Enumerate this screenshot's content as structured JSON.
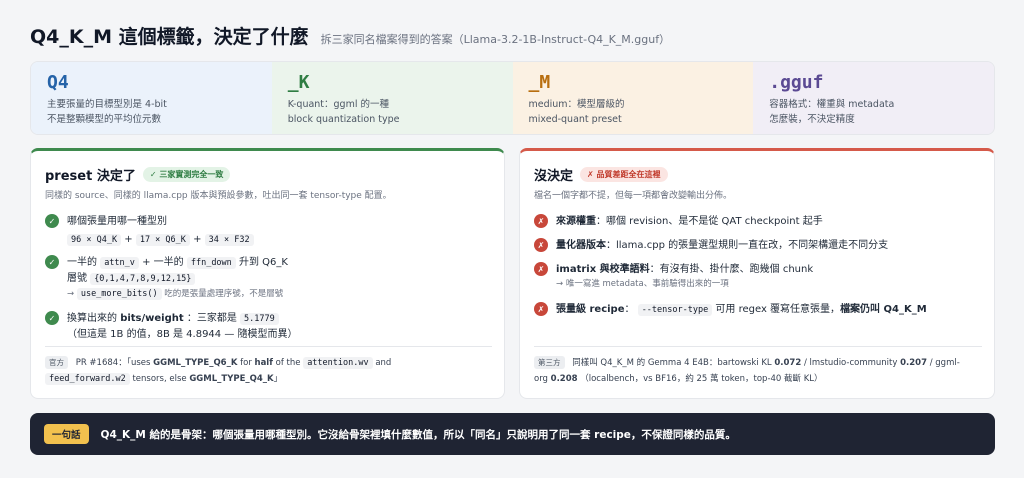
{
  "header": {
    "title": "Q4_K_M 這個標籤，決定了什麼",
    "subtitle": "拆三家同名檔案得到的答案（Llama-3.2-1B-Instruct-Q4_K_M.gguf）"
  },
  "tokens": [
    {
      "name": "Q4",
      "line1": "主要張量的目標型別是 4-bit",
      "line2": "不是整顆模型的平均位元數"
    },
    {
      "name": "_K",
      "line1": "K-quant：ggml 的一種",
      "line2": "block quantization type"
    },
    {
      "name": "_M",
      "line1": "medium：模型層級的",
      "line2": "mixed-quant preset"
    },
    {
      "name": ".gguf",
      "line1": "容器格式：權重與 metadata",
      "line2": "怎麼裝，不決定精度"
    }
  ],
  "left": {
    "title": "preset 決定了",
    "badge": "✓ 三家實測完全一致",
    "subtitle": "同樣的 source、同樣的 llama.cpp 版本與預設參數，吐出同一套 tensor-type 配置。",
    "item1": {
      "title": "哪個張量用哪一種型別",
      "c1": "96 × Q4_K",
      "c2": "17 × Q6_K",
      "c3": "34 × F32",
      "plus": "+"
    },
    "item2": {
      "t1": "一半的",
      "c1": "attn_v",
      "t2": "+ 一半的",
      "c2": "ffn_down",
      "t3": "升到 Q6_K",
      "l2a": "層號",
      "l2code": "{0,1,4,7,8,9,12,15}",
      "arrow": "→",
      "l3code": "use_more_bits()",
      "l3text": "吃的是張量處理序號，不是層號"
    },
    "item3": {
      "t1": "換算出來的",
      "bold": "bits/weight",
      "t2": "：三家都是",
      "c1": "5.1779",
      "l2": "（但這是 1B 的值，8B 是 4.8944 — 隨模型而異）"
    },
    "foot": {
      "tag": "官方",
      "a": "PR #1684：「uses",
      "b1": "GGML_TYPE_Q6_K",
      "c": "for",
      "b2": "half",
      "d": "of the",
      "code1": "attention.wv",
      "e": "and",
      "code2": "feed_forward.w2",
      "f": "tensors, else",
      "b3": "GGML_TYPE_Q4_K",
      "g": "」"
    }
  },
  "right": {
    "title": "沒決定",
    "badge": "✗ 品質差距全在這裡",
    "subtitle": "檔名一個字都不提，但每一項都會改變輸出分佈。",
    "item1": {
      "b": "來源權重",
      "t": "：哪個 revision、是不是從 QAT checkpoint 起手"
    },
    "item2": {
      "b": "量化器版本",
      "t": "：llama.cpp 的張量選型規則一直在改，不同架構還走不同分支"
    },
    "item3": {
      "b": "imatrix 與校準語料",
      "t": "：有沒有掛、掛什麼、跑幾個 chunk",
      "note": "→ 唯一寫進 metadata、事前驗得出來的一項"
    },
    "item4": {
      "b": "張量級 recipe",
      "t1": "：",
      "code": "--tensor-type",
      "t2": "可用 regex 覆寫任意張量，",
      "b2": "檔案仍叫 Q4_K_M"
    },
    "foot": {
      "tag": "第三方",
      "a": "同樣叫 Q4_K_M 的 Gemma 4 E4B：bartowski KL",
      "n1": "0.072",
      "b": "/ lmstudio-community",
      "n2": "0.207",
      "c": "/ ggml-",
      "d": "org",
      "n3": "0.208",
      "e": "（localbench，vs BF16，約 25 萬 token，top-40 截斷 KL）"
    }
  },
  "bottom": {
    "pill": "一句話",
    "text": "Q4_K_M 給的是骨架：哪個張量用哪種型別。它沒給骨架裡填什麼數值，所以「同名」只說明用了同一套 recipe，不保證同樣的品質。"
  }
}
